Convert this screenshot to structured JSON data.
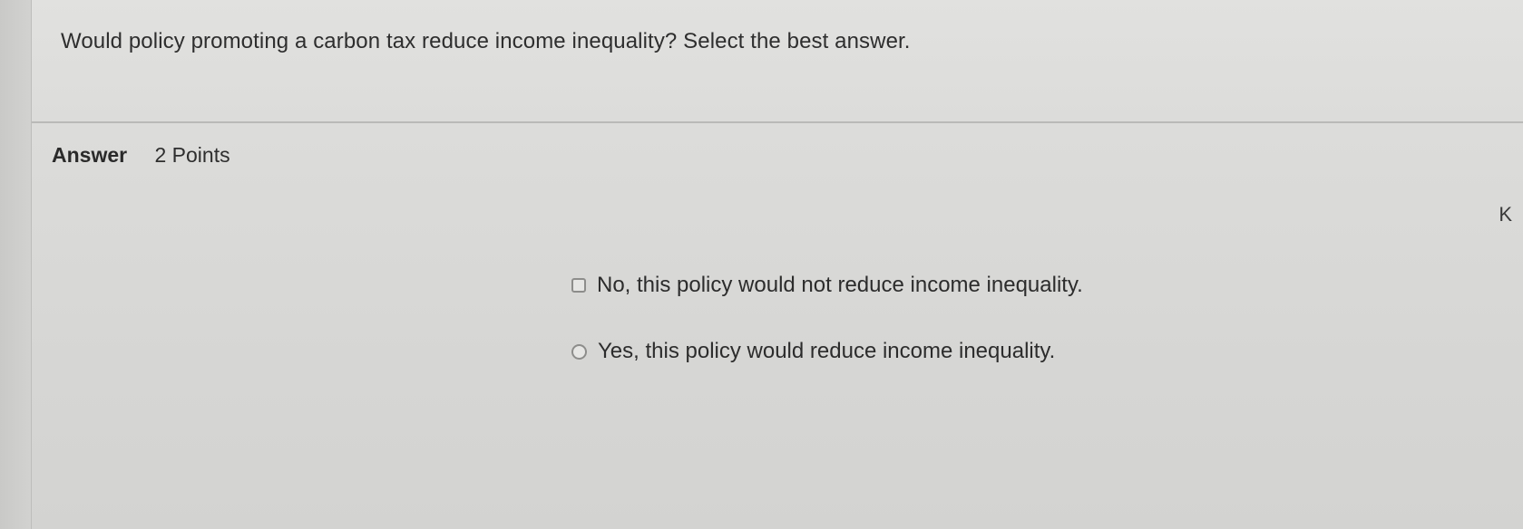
{
  "question": {
    "text": "Would policy promoting a carbon tax reduce income inequality? Select the best answer."
  },
  "answer": {
    "label": "Answer",
    "points": "2 Points"
  },
  "side_letter": "K",
  "options": [
    {
      "label": "No, this policy would not reduce income inequality.",
      "selected": false
    },
    {
      "label": "Yes, this policy would reduce income inequality.",
      "selected": false
    }
  ],
  "colors": {
    "background": "#d9d9d7",
    "text": "#2b2b2b",
    "divider": "#b9b9b7"
  }
}
